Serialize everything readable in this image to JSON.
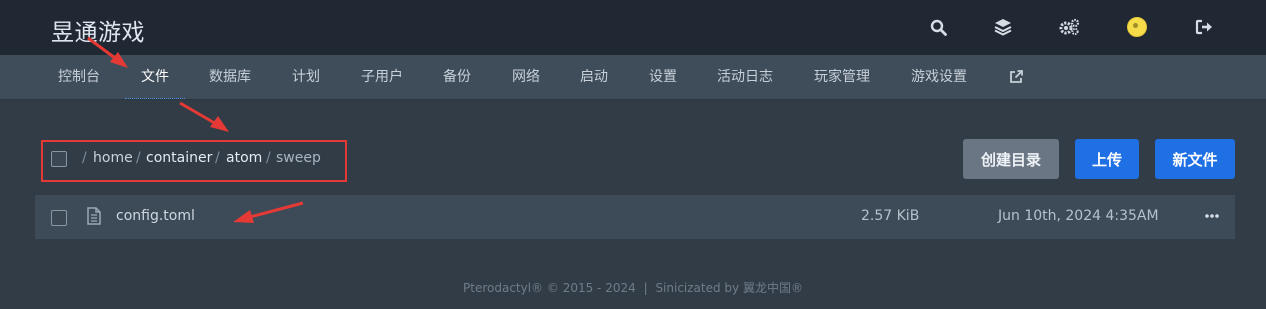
{
  "brand": {
    "title": "昱通游戏"
  },
  "top_icons": [
    "search-icon",
    "layers-icon",
    "cogs-icon",
    "user-avatar",
    "sign-out-icon"
  ],
  "tabs": [
    {
      "label": "控制台"
    },
    {
      "label": "文件",
      "active": true
    },
    {
      "label": "数据库"
    },
    {
      "label": "计划"
    },
    {
      "label": "子用户"
    },
    {
      "label": "备份"
    },
    {
      "label": "网络"
    },
    {
      "label": "启动"
    },
    {
      "label": "设置"
    },
    {
      "label": "活动日志"
    },
    {
      "label": "玩家管理"
    },
    {
      "label": "游戏设置"
    }
  ],
  "breadcrumb": {
    "sep": "/",
    "parts": [
      "home",
      "container",
      "atom",
      "sweep"
    ]
  },
  "actions": {
    "create_dir": "创建目录",
    "upload": "上传",
    "new_file": "新文件"
  },
  "files": [
    {
      "name": "config.toml",
      "size": "2.57 KiB",
      "modified": "Jun 10th, 2024 4:35AM"
    }
  ],
  "footer": {
    "left": "Pterodactyl® © 2015 - 2024",
    "divider": "|",
    "right": "Sinicizated by 翼龙中国®"
  },
  "colors": {
    "accent": "#1f6fe5",
    "annotation": "#e53935",
    "topbar": "#1f2833",
    "subnav": "#3f4d5a"
  }
}
